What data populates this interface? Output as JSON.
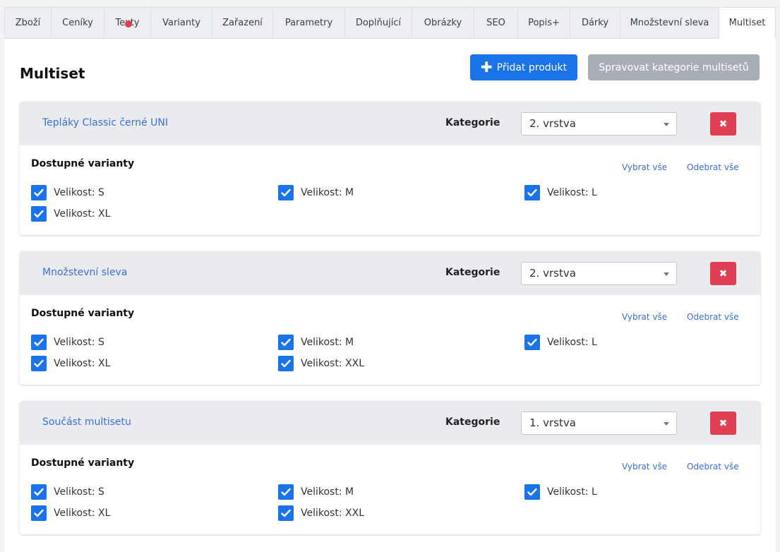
{
  "tabs": [
    {
      "label": "Zboží",
      "width": 66
    },
    {
      "label": "Ceníky",
      "width": 75
    },
    {
      "label": "Texty",
      "width": 66,
      "has_dot": true
    },
    {
      "label": "Varianty",
      "width": 87
    },
    {
      "label": "Zařazení",
      "width": 86
    },
    {
      "label": "Parametry",
      "width": 102
    },
    {
      "label": "Doplňující",
      "width": 95
    },
    {
      "label": "Obrázky",
      "width": 88
    },
    {
      "label": "SEO",
      "width": 62
    },
    {
      "label": "Popis+",
      "width": 74
    },
    {
      "label": "Dárky",
      "width": 71
    },
    {
      "label": "Množstevní sleva",
      "width": 140
    },
    {
      "label": "Multiset",
      "width": 81,
      "active": true
    }
  ],
  "page_title": "Multiset",
  "add_product_label": "Přidat produkt",
  "manage_categories_label": "Spravovat kategorie multisetů",
  "category_label": "Kategorie",
  "available_variants_label": "Dostupné varianty",
  "select_all_label": "Vybrat vše",
  "deselect_all_label": "Odebrat vše",
  "colors": {
    "primary": "#1a73e8",
    "danger": "#e03e52",
    "link": "#3c6fd6",
    "secondary": "#a8aeb6"
  },
  "items": [
    {
      "name": "Tepláky Classic černé UNI",
      "category": "2. vrstva",
      "variants": [
        "Velikost: S",
        "Velikost: M",
        "Velikost: L",
        "Velikost: XL"
      ]
    },
    {
      "name": "Množstevní sleva",
      "category": "2. vrstva",
      "variants": [
        "Velikost: S",
        "Velikost: M",
        "Velikost: L",
        "Velikost: XL",
        "Velikost: XXL"
      ]
    },
    {
      "name": "Součást multisetu",
      "category": "1. vrstva",
      "variants": [
        "Velikost: S",
        "Velikost: M",
        "Velikost: L",
        "Velikost: XL",
        "Velikost: XXL"
      ]
    }
  ]
}
